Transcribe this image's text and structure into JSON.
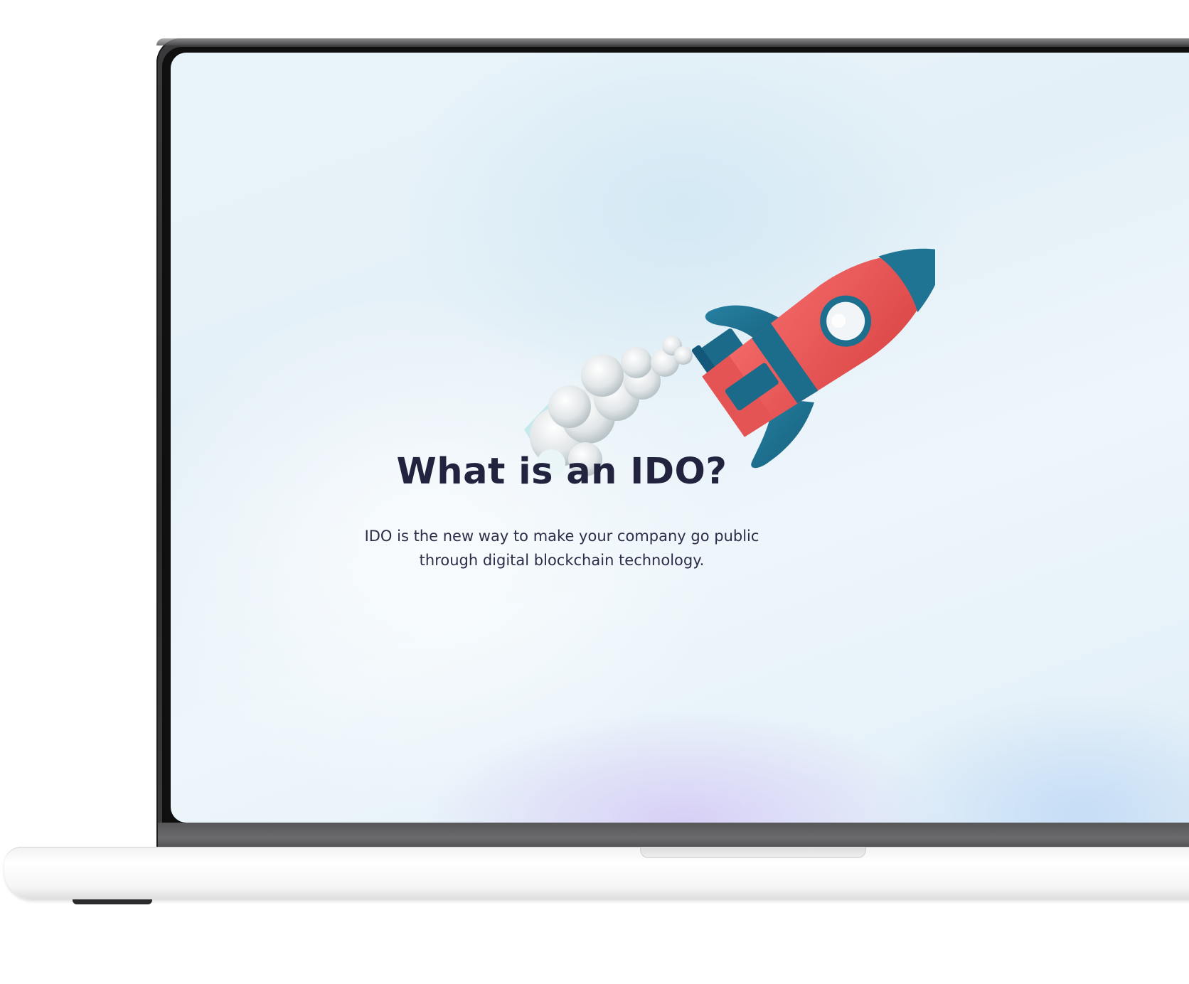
{
  "hero": {
    "title": "What is an IDO?",
    "description": "IDO is the new way to make your company go public through digital blockchain technology."
  },
  "colors": {
    "rocket_body": "#ef5f5f",
    "rocket_fins": "#1e6f8e",
    "title_text": "#22233f",
    "body_text": "#2c2d48"
  },
  "icons": {
    "illustration": "rocket-icon"
  }
}
